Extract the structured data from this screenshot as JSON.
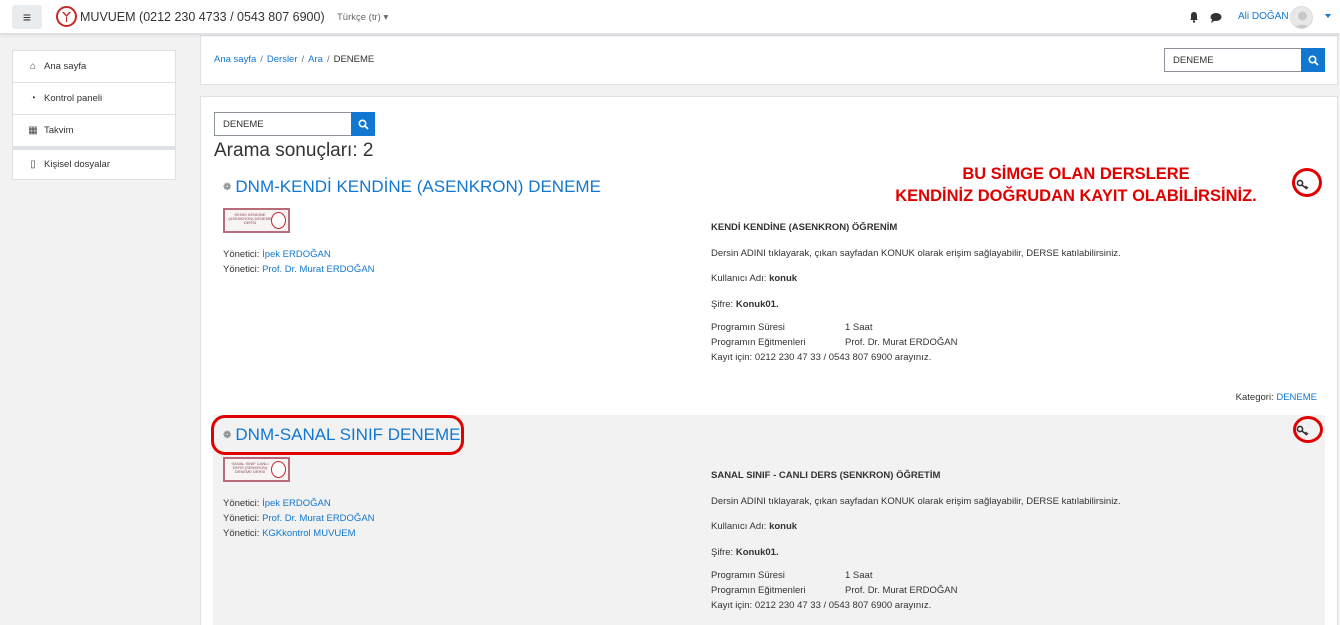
{
  "navbar": {
    "site_name": "MUVUEM (0212 230 4733 / 0543 807 6900)",
    "language": "Türkçe (tr)",
    "user_name": "Ali DOĞAN",
    "menu_icon": "hamburger-icon"
  },
  "drawer": {
    "items": [
      {
        "label": "Ana sayfa",
        "icon": "home-icon"
      },
      {
        "label": "Kontrol paneli",
        "icon": "dashboard-icon"
      },
      {
        "label": "Takvim",
        "icon": "calendar-icon"
      },
      {
        "label": "Kişisel dosyalar",
        "icon": "file-icon"
      }
    ]
  },
  "breadcrumb": {
    "items": [
      "Ana sayfa",
      "Dersler",
      "Ara"
    ],
    "current": "DENEME"
  },
  "header_search": {
    "value": "DENEME"
  },
  "search": {
    "value": "DENEME",
    "results_title": "Arama sonuçları: 2"
  },
  "courses": [
    {
      "name": "DNM-KENDİ KENDİNE (ASENKRON) DENEME",
      "image_text": "KENDİ KENDİNE (ASENKRON) DENEME DERSİ",
      "teachers": [
        {
          "role": "Yönetici:",
          "name": "İpek ERDOĞAN"
        },
        {
          "role": "Yönetici:",
          "name": "Prof. Dr. Murat ERDOĞAN"
        }
      ],
      "summary_title": "KENDİ KENDİNE (ASENKRON) ÖĞRENİM",
      "summary_access": "Dersin ADINI tıklayarak, çıkan sayfadan KONUK olarak erişim sağlayabilir, DERSE katılabilirsiniz.",
      "username_label": "Kullanıcı Adı:",
      "username": "konuk",
      "password_label": "Şifre:",
      "password": "Konuk01.",
      "program_duration_label": "Programın Süresi",
      "program_duration": "1 Saat",
      "program_trainers_label": "Programın Eğitmenleri",
      "program_trainers": "Prof. Dr. Murat ERDOĞAN",
      "registration": "Kayıt için: 0212 230 47 33  / 0543 807 6900 arayınız.",
      "category_label": "Kategori:",
      "category": "DENEME"
    },
    {
      "name": "DNM-SANAL SINIF DENEME",
      "image_text": "SANAL SINIF CANLI DERS (SENKRON) DENEME DERSİ",
      "teachers": [
        {
          "role": "Yönetici:",
          "name": "İpek ERDOĞAN"
        },
        {
          "role": "Yönetici:",
          "name": "Prof. Dr. Murat ERDOĞAN"
        },
        {
          "role": "Yönetici:",
          "name": "KGKkontrol MUVUEM"
        }
      ],
      "summary_title": "SANAL SINIF - CANLI DERS (SENKRON) ÖĞRETİM",
      "summary_access": "Dersin ADINI tıklayarak, çıkan sayfadan KONUK olarak erişim sağlayabilir, DERSE katılabilirsiniz.",
      "username_label": "Kullanıcı Adı:",
      "username": "konuk",
      "password_label": "Şifre:",
      "password": "Konuk01.",
      "program_duration_label": "Programın Süresi",
      "program_duration": "1 Saat",
      "program_trainers_label": "Programın Eğitmenleri",
      "program_trainers": "Prof. Dr. Murat ERDOĞAN",
      "registration": "Kayıt için: 0212 230 47 33  / 0543 807 6900 arayınız."
    }
  ],
  "annotation": {
    "line1": "BU SİMGE OLAN DERSLERE",
    "line2": "KENDİNİZ DOĞRUDAN KAYIT OLABİLİRSİNİZ.",
    "color": "#e00000"
  },
  "colors": {
    "link": "#1177d1",
    "annotation_red": "#e00000",
    "background": "#f2f2f2"
  }
}
